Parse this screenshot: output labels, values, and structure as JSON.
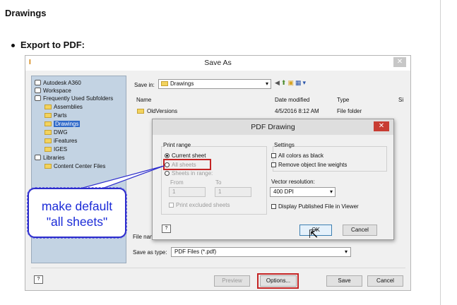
{
  "heading": "Drawings",
  "bullet": "Export to PDF:",
  "saveas": {
    "title": "Save As",
    "close": "✕",
    "tree": [
      {
        "label": "Autodesk A360",
        "kind": "globe"
      },
      {
        "label": "Workspace",
        "kind": "globe"
      },
      {
        "label": "Frequently Used Subfolders",
        "kind": "globe"
      },
      {
        "label": "Assemblies",
        "kind": "folder"
      },
      {
        "label": "Parts",
        "kind": "folder"
      },
      {
        "label": "Drawings",
        "kind": "folder",
        "selected": true
      },
      {
        "label": "DWG",
        "kind": "folder"
      },
      {
        "label": "iFeatures",
        "kind": "folder"
      },
      {
        "label": "IGES",
        "kind": "folder"
      },
      {
        "label": "Libraries",
        "kind": "globe"
      },
      {
        "label": "Content Center Files",
        "kind": "folder"
      }
    ],
    "save_in_label": "Save in:",
    "save_in_value": "Drawings",
    "columns": {
      "name": "Name",
      "date": "Date modified",
      "type": "Type",
      "size": "Si"
    },
    "files": [
      {
        "name": "OldVersions",
        "date": "4/5/2016 8:12 AM",
        "type": "File folder"
      }
    ],
    "file_name_label": "File nam",
    "save_as_type_label": "Save as type:",
    "save_as_type_value": "PDF Files (*.pdf)",
    "help": "?",
    "preview": "Preview",
    "options": "Options...",
    "save": "Save",
    "cancel": "Cancel"
  },
  "pdf": {
    "title": "PDF Drawing",
    "close": "✕",
    "print_range": "Print range",
    "current_sheet": "Current sheet",
    "all_sheets": "All sheets",
    "sheets_in_range": "Sheets in range:",
    "from_label": "From",
    "to_label": "To",
    "from_value": "1",
    "to_value": "1",
    "print_excluded": "Print excluded sheets",
    "settings": "Settings",
    "all_colors_black": "All colors as black",
    "remove_line_weights": "Remove object line weights",
    "vector_resolution": "Vector resolution:",
    "dpi": "400 DPI",
    "display_published": "Display Published File in Viewer",
    "ok": "OK",
    "cancel": "Cancel",
    "help": "?"
  },
  "callout": {
    "line1": "make default",
    "line2": "\"all sheets\""
  },
  "colors": {
    "red_highlight": "#c42424",
    "callout_blue": "#1b2bd8",
    "selection": "#2e68c8"
  }
}
